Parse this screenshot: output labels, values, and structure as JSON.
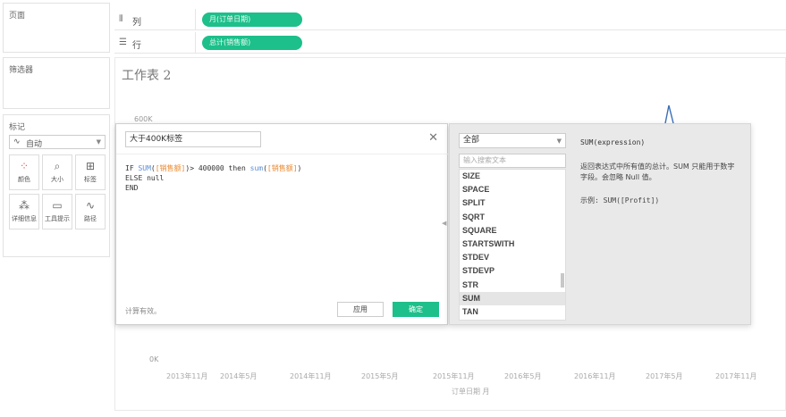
{
  "panels": {
    "pages": "页面",
    "filters": "筛选器",
    "marks": "标记"
  },
  "marks": {
    "type_value": "自动",
    "buttons": [
      {
        "label": "颜色",
        "icon": "dots-icon",
        "glyph": "⁘"
      },
      {
        "label": "大小",
        "icon": "size-icon",
        "glyph": "⌕"
      },
      {
        "label": "标签",
        "icon": "label-icon",
        "glyph": "⊞"
      },
      {
        "label": "详细信息",
        "icon": "detail-icon",
        "glyph": "⁂"
      },
      {
        "label": "工具提示",
        "icon": "tooltip-icon",
        "glyph": "▭"
      },
      {
        "label": "路径",
        "icon": "path-icon",
        "glyph": "∿"
      }
    ]
  },
  "shelves": {
    "columns_label": "列",
    "columns_pill": "月(订单日期)",
    "rows_label": "行",
    "rows_pill": "总计(销售额)"
  },
  "worksheet": {
    "title": "工作表 2",
    "y_ticks": [
      "600K",
      "0K"
    ],
    "x_ticks": [
      "2013年11月",
      "2014年5月",
      "2014年11月",
      "2015年5月",
      "2015年11月",
      "2016年5月",
      "2016年11月",
      "2017年5月",
      "2017年11月"
    ],
    "x_label": "订单日期 月"
  },
  "calc": {
    "name": "大于400K标签",
    "code_lines": [
      [
        {
          "t": "IF ",
          "c": ""
        },
        {
          "t": "SUM",
          "c": "fn"
        },
        {
          "t": "(",
          "c": ""
        },
        {
          "t": "[销售额]",
          "c": "fld"
        },
        {
          "t": ")> 400000 then ",
          "c": ""
        },
        {
          "t": "sum",
          "c": "fn"
        },
        {
          "t": "(",
          "c": ""
        },
        {
          "t": "[销售额]",
          "c": "fld"
        },
        {
          "t": ")",
          "c": ""
        }
      ],
      [
        {
          "t": "ELSE null",
          "c": ""
        }
      ],
      [
        {
          "t": "END",
          "c": ""
        }
      ]
    ],
    "status": "计算有效。",
    "apply": "应用",
    "ok": "确定"
  },
  "functions": {
    "category": "全部",
    "search_placeholder": "输入搜索文本",
    "items": [
      "SIZE",
      "SPACE",
      "SPLIT",
      "SQRT",
      "SQUARE",
      "STARTSWITH",
      "STDEV",
      "STDEVP",
      "STR",
      "SUM",
      "TAN"
    ],
    "selected": "SUM",
    "signature": "SUM(expression)",
    "description": "返回表达式中所有值的总计。SUM 只能用于数字字段。会忽略 Null 值。",
    "example": "示例: SUM([Profit])"
  },
  "colors": {
    "accent": "#1dbf8a",
    "function": "#5b8ed6",
    "field": "#e9872c",
    "line": "#3b6fb6"
  }
}
